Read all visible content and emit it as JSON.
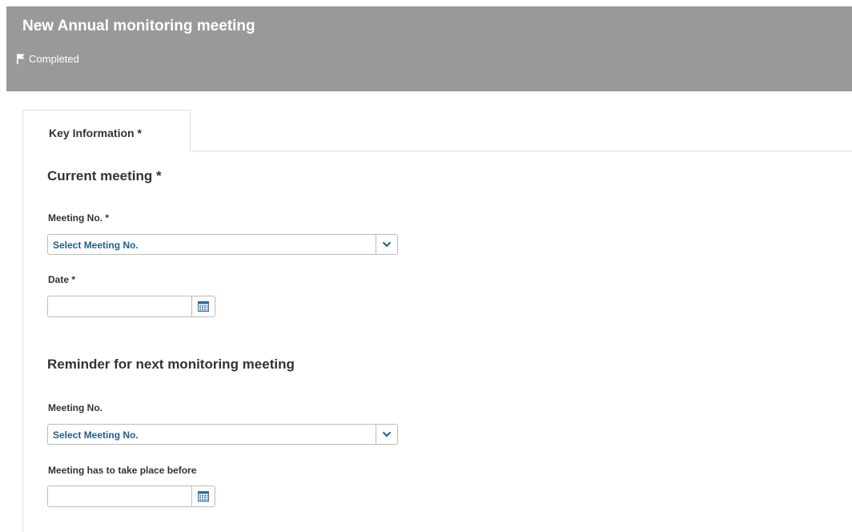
{
  "header": {
    "title": "New Annual monitoring meeting",
    "status": "Completed"
  },
  "tabs": [
    {
      "label": "Key Information *",
      "active": true
    }
  ],
  "current_meeting": {
    "title": "Current meeting *",
    "meeting_no": {
      "label": "Meeting No. *",
      "selected": "Select Meeting No."
    },
    "date": {
      "label": "Date *",
      "value": ""
    }
  },
  "reminder": {
    "title": "Reminder for next monitoring meeting",
    "meeting_no": {
      "label": "Meeting No.",
      "selected": "Select Meeting No."
    },
    "before_date": {
      "label": "Meeting has to take place before",
      "value": ""
    }
  },
  "icons": {
    "status": "flag-icon",
    "select_toggle": "chevron-down-icon",
    "date_picker": "calendar-icon"
  },
  "colors": {
    "header_bg": "#999999",
    "select_text": "#1f5f8b",
    "accent": "#1f5f8b"
  }
}
